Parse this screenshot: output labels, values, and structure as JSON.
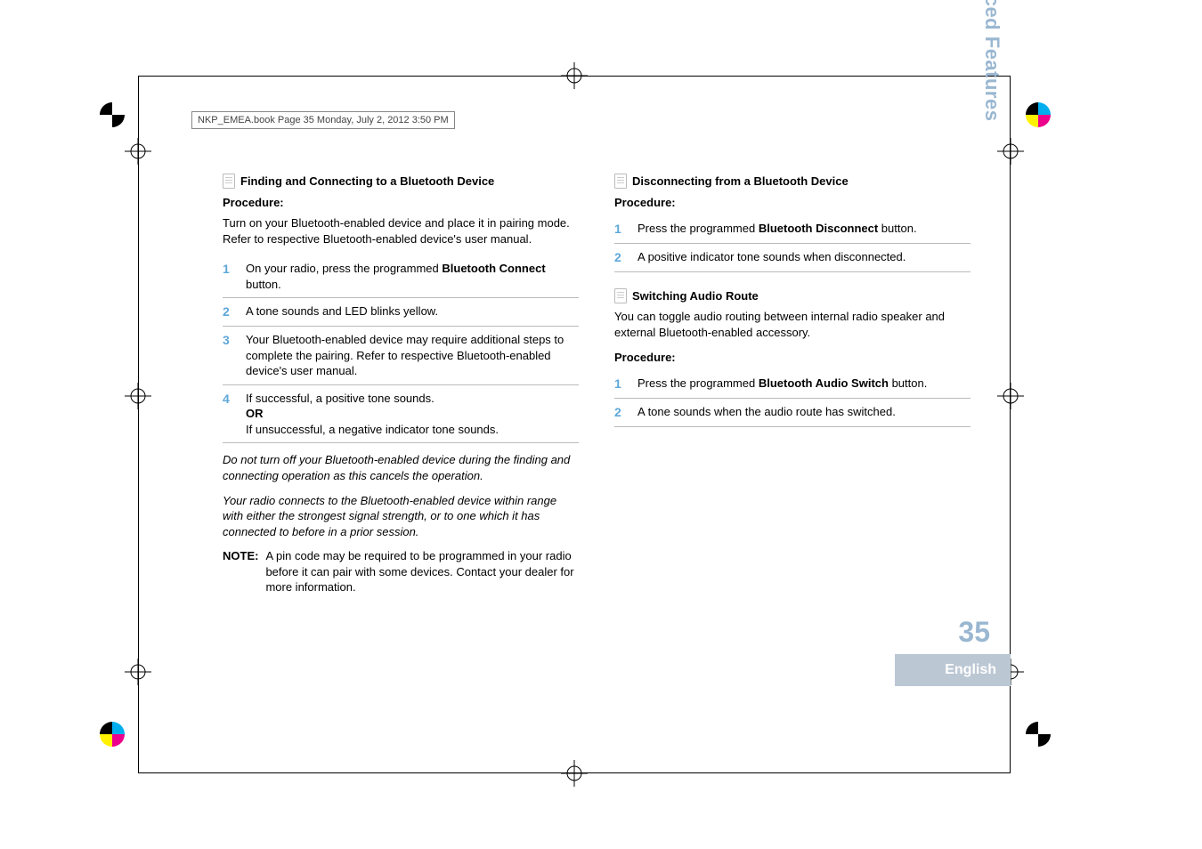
{
  "meta": {
    "header": "NKP_EMEA.book  Page 35  Monday, July 2, 2012  3:50 PM",
    "side_label": "Advanced Features",
    "page_number": "35",
    "language": "English"
  },
  "left": {
    "heading": "Finding and Connecting to a Bluetooth Device",
    "procedure_label": "Procedure:",
    "intro": "Turn on your Bluetooth-enabled device and place it in pairing mode. Refer to respective Bluetooth-enabled device's user manual.",
    "steps": [
      {
        "n": "1",
        "pre": "On your radio, press the programmed ",
        "bold": "Bluetooth Connect",
        "post": " button."
      },
      {
        "n": "2",
        "pre": "A tone sounds and LED blinks yellow.",
        "bold": "",
        "post": ""
      },
      {
        "n": "3",
        "pre": "Your Bluetooth-enabled device may require additional steps to complete the pairing. Refer to respective Bluetooth-enabled device's user manual.",
        "bold": "",
        "post": ""
      },
      {
        "n": "4",
        "pre": "If successful, a positive tone sounds.",
        "bold": "",
        "post": "",
        "or": "OR",
        "after_or": "If unsuccessful, a negative indicator tone sounds."
      }
    ],
    "italic1": "Do not turn off your Bluetooth-enabled device during the finding and connecting operation as this cancels the operation.",
    "italic2": "Your radio connects to the Bluetooth-enabled device within range with either the strongest signal strength, or to one which it has connected to before in a prior session.",
    "note_label": "NOTE:",
    "note_text": "A pin code may be required to be programmed in your radio before it can pair with some devices. Contact your dealer for more information."
  },
  "right": {
    "sec1": {
      "heading": "Disconnecting from a Bluetooth Device",
      "procedure_label": "Procedure:",
      "steps": [
        {
          "n": "1",
          "pre": "Press the programmed ",
          "bold": "Bluetooth Disconnect",
          "post": " button."
        },
        {
          "n": "2",
          "pre": "A positive indicator tone sounds when disconnected.",
          "bold": "",
          "post": ""
        }
      ]
    },
    "sec2": {
      "heading": "Switching Audio Route",
      "intro": "You can toggle audio routing between internal radio speaker and external Bluetooth-enabled accessory.",
      "procedure_label": "Procedure:",
      "steps": [
        {
          "n": "1",
          "pre": "Press the programmed ",
          "bold": "Bluetooth Audio Switch",
          "post": " button."
        },
        {
          "n": "2",
          "pre": "A tone sounds when the audio route has switched.",
          "bold": "",
          "post": ""
        }
      ]
    }
  }
}
